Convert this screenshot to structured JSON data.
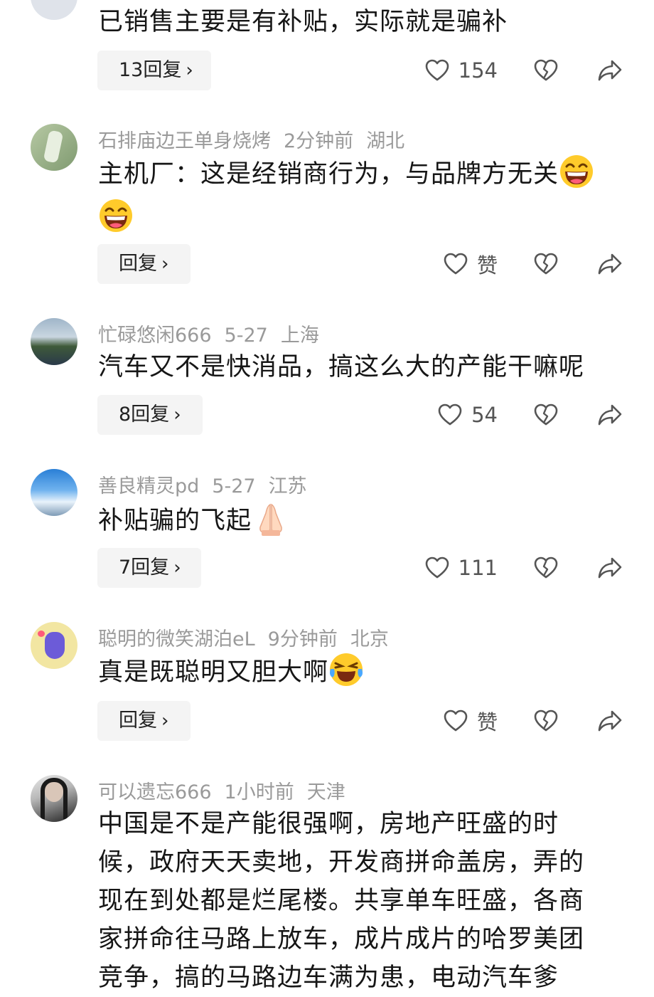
{
  "comments": [
    {
      "text": "已销售主要是有补贴，实际就是骗补",
      "reply_label": "13回复",
      "like_label": "154"
    },
    {
      "username": "石排庙边王单身烧烤",
      "time": "2分钟前",
      "location": "湖北",
      "text": "主机厂：这是经销商行为，与品牌方无关",
      "reply_label": "回复",
      "like_label": "赞"
    },
    {
      "username": "忙碌悠闲666",
      "time": "5-27",
      "location": "上海",
      "text": "汽车又不是快消品，搞这么大的产能干嘛呢",
      "reply_label": "8回复",
      "like_label": "54"
    },
    {
      "username": "善良精灵pd",
      "time": "5-27",
      "location": "江苏",
      "text": "补贴骗的飞起",
      "reply_label": "7回复",
      "like_label": "111"
    },
    {
      "username": "聪明的微笑湖泊eL",
      "time": "9分钟前",
      "location": "北京",
      "text": "真是既聪明又胆大啊",
      "reply_label": "回复",
      "like_label": "赞"
    },
    {
      "username": "可以遗忘666",
      "time": "1小时前",
      "location": "天津",
      "text": "中国是不是产能很强啊，房地产旺盛的时候，政府天天卖地，开发商拼命盖房，弄的现在到处都是烂尾楼。共享单车旺盛，各商家拼命往马路上放车，成片成片的哈罗美团竞争，搞的马路边车满为患，电动汽车爹"
    }
  ],
  "chevron": "›"
}
